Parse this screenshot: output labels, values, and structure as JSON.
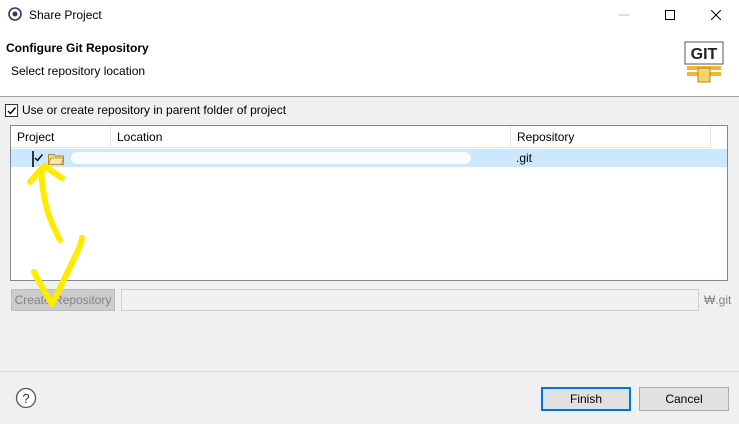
{
  "window": {
    "title": "Share Project"
  },
  "header": {
    "title": "Configure Git Repository",
    "description": "Select repository location",
    "logo_text": "GIT"
  },
  "options": {
    "use_parent_label": "Use or create repository in parent folder of project",
    "use_parent_checked": true
  },
  "table": {
    "columns": [
      "Project",
      "Location",
      "Repository"
    ],
    "rows": [
      {
        "project": "",
        "location": "",
        "repository": ".git",
        "checked": true,
        "selected": true
      }
    ]
  },
  "create": {
    "button_label": "Create Repository",
    "path_value": "",
    "suffix": "₩.git"
  },
  "footer": {
    "finish_label": "Finish",
    "cancel_label": "Cancel"
  },
  "colors": {
    "selection": "#cce8ff",
    "default_button_border": "#0078d7",
    "annotation": "#ffeb00"
  }
}
